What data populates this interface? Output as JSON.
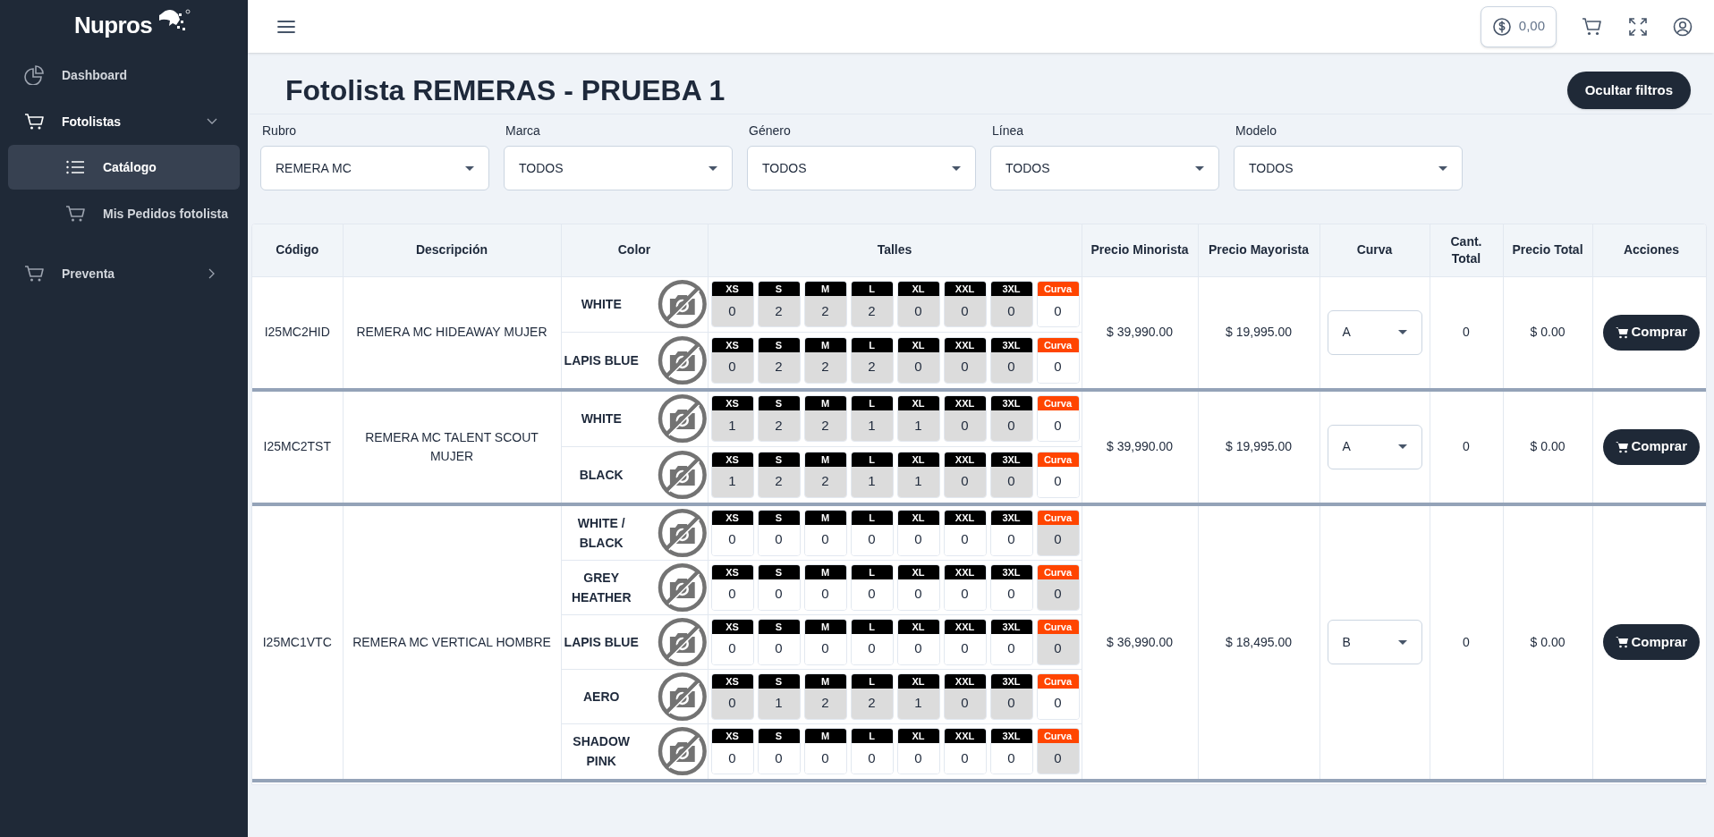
{
  "sidebar": {
    "logo": "Nupros",
    "items": [
      {
        "kind": "chart",
        "label": "Dashboard"
      },
      {
        "kind": "cart",
        "label": "Fotolistas",
        "expanded": true,
        "children": [
          {
            "kind": "list",
            "label": "Catálogo",
            "selected": true
          },
          {
            "kind": "cart",
            "label": "Mis Pedidos fotolista",
            "selected": false
          }
        ]
      },
      {
        "kind": "cart",
        "label": "Preventa",
        "expanded": false
      }
    ]
  },
  "header": {
    "balance": "0,00"
  },
  "page": {
    "title": "Fotolista REMERAS - PRUEBA 1",
    "filter_button": "Ocultar filtros"
  },
  "filters": [
    {
      "label": "Rubro",
      "value": "REMERA MC"
    },
    {
      "label": "Marca",
      "value": "TODOS"
    },
    {
      "label": "Género",
      "value": "TODOS"
    },
    {
      "label": "Línea",
      "value": "TODOS"
    },
    {
      "label": "Modelo",
      "value": "TODOS"
    }
  ],
  "table": {
    "columns": [
      "Código",
      "Descripción",
      "Color",
      "Talles",
      "Precio Minorista",
      "Precio Mayorista",
      "Curva",
      "Cant. Total",
      "Precio Total",
      "Acciones"
    ],
    "rows": [
      {
        "code": "I25MC2HID",
        "description": "REMERA MC HIDEAWAY MUJER",
        "price_retail": "$ 39,990.00",
        "price_wholesale": "$ 19,995.00",
        "curve": "A",
        "qty": "0",
        "total": "$ 0.00",
        "action": "Comprar",
        "colors": [
          {
            "name": "WHITE",
            "cells": [
              {
                "kind": "size",
                "label": "XS",
                "value": "0",
                "disabled": true
              },
              {
                "kind": "size",
                "label": "S",
                "value": "2",
                "disabled": true
              },
              {
                "kind": "size",
                "label": "M",
                "value": "2",
                "disabled": true
              },
              {
                "kind": "size",
                "label": "L",
                "value": "2",
                "disabled": true
              },
              {
                "kind": "size",
                "label": "XL",
                "value": "0",
                "disabled": true
              },
              {
                "kind": "size",
                "label": "XXL",
                "value": "0",
                "disabled": true
              },
              {
                "kind": "size",
                "label": "3XL",
                "value": "0",
                "disabled": true
              },
              {
                "kind": "curve",
                "label": "Curva",
                "value": "0",
                "disabled": false
              }
            ]
          },
          {
            "name": "LAPIS BLUE",
            "cells": [
              {
                "kind": "size",
                "label": "XS",
                "value": "0",
                "disabled": true
              },
              {
                "kind": "size",
                "label": "S",
                "value": "2",
                "disabled": true
              },
              {
                "kind": "size",
                "label": "M",
                "value": "2",
                "disabled": true
              },
              {
                "kind": "size",
                "label": "L",
                "value": "2",
                "disabled": true
              },
              {
                "kind": "size",
                "label": "XL",
                "value": "0",
                "disabled": true
              },
              {
                "kind": "size",
                "label": "XXL",
                "value": "0",
                "disabled": true
              },
              {
                "kind": "size",
                "label": "3XL",
                "value": "0",
                "disabled": true
              },
              {
                "kind": "curve",
                "label": "Curva",
                "value": "0",
                "disabled": false
              }
            ]
          }
        ]
      },
      {
        "code": "I25MC2TST",
        "description": "REMERA MC TALENT SCOUT MUJER",
        "price_retail": "$ 39,990.00",
        "price_wholesale": "$ 19,995.00",
        "curve": "A",
        "qty": "0",
        "total": "$ 0.00",
        "action": "Comprar",
        "colors": [
          {
            "name": "WHITE",
            "cells": [
              {
                "kind": "size",
                "label": "XS",
                "value": "1",
                "disabled": true
              },
              {
                "kind": "size",
                "label": "S",
                "value": "2",
                "disabled": true
              },
              {
                "kind": "size",
                "label": "M",
                "value": "2",
                "disabled": true
              },
              {
                "kind": "size",
                "label": "L",
                "value": "1",
                "disabled": true
              },
              {
                "kind": "size",
                "label": "XL",
                "value": "1",
                "disabled": true
              },
              {
                "kind": "size",
                "label": "XXL",
                "value": "0",
                "disabled": true
              },
              {
                "kind": "size",
                "label": "3XL",
                "value": "0",
                "disabled": true
              },
              {
                "kind": "curve",
                "label": "Curva",
                "value": "0",
                "disabled": false
              }
            ]
          },
          {
            "name": "BLACK",
            "cells": [
              {
                "kind": "size",
                "label": "XS",
                "value": "1",
                "disabled": true
              },
              {
                "kind": "size",
                "label": "S",
                "value": "2",
                "disabled": true
              },
              {
                "kind": "size",
                "label": "M",
                "value": "2",
                "disabled": true
              },
              {
                "kind": "size",
                "label": "L",
                "value": "1",
                "disabled": true
              },
              {
                "kind": "size",
                "label": "XL",
                "value": "1",
                "disabled": true
              },
              {
                "kind": "size",
                "label": "XXL",
                "value": "0",
                "disabled": true
              },
              {
                "kind": "size",
                "label": "3XL",
                "value": "0",
                "disabled": true
              },
              {
                "kind": "curve",
                "label": "Curva",
                "value": "0",
                "disabled": false
              }
            ]
          }
        ]
      },
      {
        "code": "I25MC1VTC",
        "description": "REMERA MC VERTICAL HOMBRE",
        "price_retail": "$ 36,990.00",
        "price_wholesale": "$ 18,495.00",
        "curve": "B",
        "qty": "0",
        "total": "$ 0.00",
        "action": "Comprar",
        "colors": [
          {
            "name": "WHITE / BLACK",
            "cells": [
              {
                "kind": "size",
                "label": "XS",
                "value": "0",
                "disabled": false
              },
              {
                "kind": "size",
                "label": "S",
                "value": "0",
                "disabled": false
              },
              {
                "kind": "size",
                "label": "M",
                "value": "0",
                "disabled": false
              },
              {
                "kind": "size",
                "label": "L",
                "value": "0",
                "disabled": false
              },
              {
                "kind": "size",
                "label": "XL",
                "value": "0",
                "disabled": false
              },
              {
                "kind": "size",
                "label": "XXL",
                "value": "0",
                "disabled": false
              },
              {
                "kind": "size",
                "label": "3XL",
                "value": "0",
                "disabled": false
              },
              {
                "kind": "curve",
                "label": "Curva",
                "value": "0",
                "disabled": true
              }
            ]
          },
          {
            "name": "GREY HEATHER",
            "cells": [
              {
                "kind": "size",
                "label": "XS",
                "value": "0",
                "disabled": false
              },
              {
                "kind": "size",
                "label": "S",
                "value": "0",
                "disabled": false
              },
              {
                "kind": "size",
                "label": "M",
                "value": "0",
                "disabled": false
              },
              {
                "kind": "size",
                "label": "L",
                "value": "0",
                "disabled": false
              },
              {
                "kind": "size",
                "label": "XL",
                "value": "0",
                "disabled": false
              },
              {
                "kind": "size",
                "label": "XXL",
                "value": "0",
                "disabled": false
              },
              {
                "kind": "size",
                "label": "3XL",
                "value": "0",
                "disabled": false
              },
              {
                "kind": "curve",
                "label": "Curva",
                "value": "0",
                "disabled": true
              }
            ]
          },
          {
            "name": "LAPIS BLUE",
            "cells": [
              {
                "kind": "size",
                "label": "XS",
                "value": "0",
                "disabled": false
              },
              {
                "kind": "size",
                "label": "S",
                "value": "0",
                "disabled": false
              },
              {
                "kind": "size",
                "label": "M",
                "value": "0",
                "disabled": false
              },
              {
                "kind": "size",
                "label": "L",
                "value": "0",
                "disabled": false
              },
              {
                "kind": "size",
                "label": "XL",
                "value": "0",
                "disabled": false
              },
              {
                "kind": "size",
                "label": "XXL",
                "value": "0",
                "disabled": false
              },
              {
                "kind": "size",
                "label": "3XL",
                "value": "0",
                "disabled": false
              },
              {
                "kind": "curve",
                "label": "Curva",
                "value": "0",
                "disabled": true
              }
            ]
          },
          {
            "name": "AERO",
            "cells": [
              {
                "kind": "size",
                "label": "XS",
                "value": "0",
                "disabled": true
              },
              {
                "kind": "size",
                "label": "S",
                "value": "1",
                "disabled": true
              },
              {
                "kind": "size",
                "label": "M",
                "value": "2",
                "disabled": true
              },
              {
                "kind": "size",
                "label": "L",
                "value": "2",
                "disabled": true
              },
              {
                "kind": "size",
                "label": "XL",
                "value": "1",
                "disabled": true
              },
              {
                "kind": "size",
                "label": "XXL",
                "value": "0",
                "disabled": true
              },
              {
                "kind": "size",
                "label": "3XL",
                "value": "0",
                "disabled": true
              },
              {
                "kind": "curve",
                "label": "Curva",
                "value": "0",
                "disabled": false
              }
            ]
          },
          {
            "name": "SHADOW PINK",
            "cells": [
              {
                "kind": "size",
                "label": "XS",
                "value": "0",
                "disabled": false
              },
              {
                "kind": "size",
                "label": "S",
                "value": "0",
                "disabled": false
              },
              {
                "kind": "size",
                "label": "M",
                "value": "0",
                "disabled": false
              },
              {
                "kind": "size",
                "label": "L",
                "value": "0",
                "disabled": false
              },
              {
                "kind": "size",
                "label": "XL",
                "value": "0",
                "disabled": false
              },
              {
                "kind": "size",
                "label": "XXL",
                "value": "0",
                "disabled": false
              },
              {
                "kind": "size",
                "label": "3XL",
                "value": "0",
                "disabled": false
              },
              {
                "kind": "curve",
                "label": "Curva",
                "value": "0",
                "disabled": true
              }
            ]
          }
        ]
      }
    ]
  }
}
